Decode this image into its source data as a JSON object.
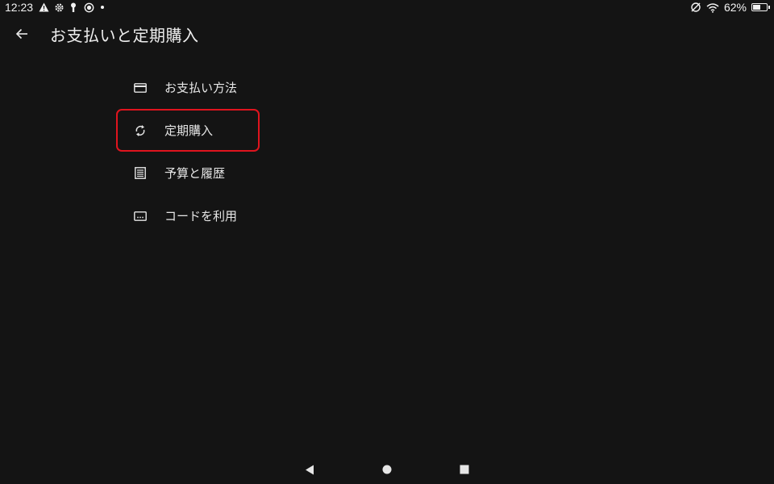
{
  "status_bar": {
    "time": "12:23",
    "battery_percent": "62%",
    "battery_level": 0.62,
    "left_icons": [
      "warning-icon",
      "gear-icon",
      "key-icon",
      "record-icon",
      "dot-icon"
    ],
    "right_icons": [
      "no-sim-icon",
      "wifi-icon",
      "battery-icon"
    ]
  },
  "header": {
    "title": "お支払いと定期購入",
    "back_icon": "arrow-left-icon"
  },
  "menu": {
    "items": [
      {
        "label": "お支払い方法",
        "icon": "credit-card-icon"
      },
      {
        "label": "定期購入",
        "icon": "sync-icon",
        "highlighted": true,
        "highlight_color": "#e0141e"
      },
      {
        "label": "予算と履歴",
        "icon": "list-icon"
      },
      {
        "label": "コードを利用",
        "icon": "code-card-icon"
      }
    ]
  },
  "nav_bar": {
    "buttons": [
      "back-triangle-icon",
      "home-circle-icon",
      "recents-square-icon"
    ]
  },
  "colors": {
    "background": "#141414",
    "text": "#e6e6e6",
    "highlight": "#e0141e"
  }
}
